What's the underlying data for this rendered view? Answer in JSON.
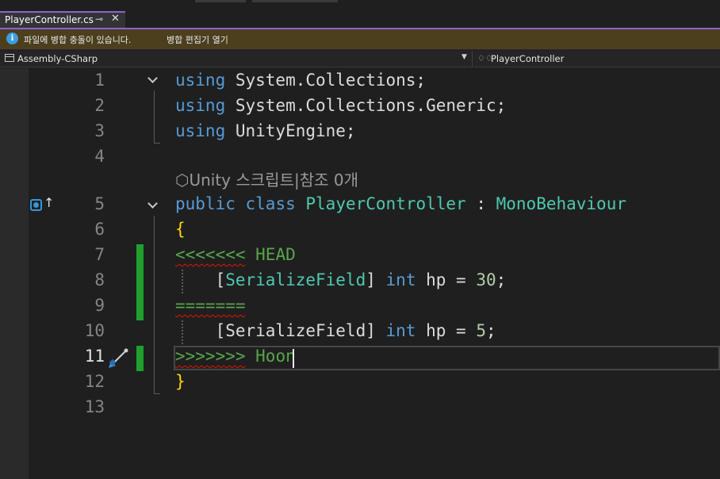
{
  "tab": {
    "title": "PlayerController.cs",
    "pin_glyph": "⊸",
    "close_glyph": "✕"
  },
  "infobar": {
    "icon": "i",
    "message": "파일에 병합 충돌이 있습니다.",
    "link": "병합 편집기 열기"
  },
  "navbar": {
    "project": "Assembly-CSharp",
    "class": "PlayerController",
    "class_icon": "♢♢"
  },
  "codelens": "⬡Unity 스크립트|참조 0개",
  "lines": [
    {
      "n": "1",
      "t": [
        [
          "using",
          "kw"
        ],
        [
          " System.Collections;",
          ""
        ]
      ]
    },
    {
      "n": "2",
      "t": [
        [
          "using",
          "kw"
        ],
        [
          " System.Collections.Generic;",
          ""
        ]
      ]
    },
    {
      "n": "3",
      "t": [
        [
          "using",
          "kw"
        ],
        [
          " UnityEngine;",
          ""
        ]
      ]
    },
    {
      "n": "4",
      "t": []
    },
    {
      "n": "5",
      "t": [
        [
          "public",
          "kw"
        ],
        [
          " ",
          ""
        ],
        [
          "class",
          "kw"
        ],
        [
          " ",
          ""
        ],
        [
          "PlayerController",
          "cls"
        ],
        [
          " : ",
          ""
        ],
        [
          "MonoBehaviour",
          "cls"
        ]
      ]
    },
    {
      "n": "6",
      "t": [
        [
          "{",
          "brace"
        ]
      ]
    },
    {
      "n": "7",
      "t": [
        [
          "<<<<<<<",
          "conflict squig"
        ],
        [
          " HEAD",
          "conflict"
        ]
      ]
    },
    {
      "n": "8",
      "t": [
        [
          "    [",
          ""
        ],
        [
          "SerializeField",
          "cls"
        ],
        [
          "] ",
          ""
        ],
        [
          "int",
          "kw"
        ],
        [
          " hp = ",
          ""
        ],
        [
          "30",
          "num"
        ],
        [
          ";",
          ""
        ]
      ]
    },
    {
      "n": "9",
      "t": [
        [
          "=======",
          "conflict squig"
        ]
      ]
    },
    {
      "n": "10",
      "t": [
        [
          "    [SerializeField] ",
          ""
        ],
        [
          "int",
          "kw"
        ],
        [
          " hp = ",
          ""
        ],
        [
          "5",
          "num"
        ],
        [
          ";",
          ""
        ]
      ]
    },
    {
      "n": "11",
      "t": [
        [
          ">>>>>>>",
          "conflict squig"
        ],
        [
          " Hoon",
          "conflict"
        ]
      ]
    },
    {
      "n": "12",
      "t": [
        [
          "}",
          "brace"
        ]
      ]
    },
    {
      "n": "13",
      "t": []
    }
  ],
  "colors": {
    "keyword": "#569cd6",
    "type": "#4ec9b0",
    "brace": "#ffd700",
    "number": "#b5cea8",
    "conflict_marker": "#57a64a",
    "accent": "#8a63d2",
    "change_bar": "#1f9f2f"
  }
}
